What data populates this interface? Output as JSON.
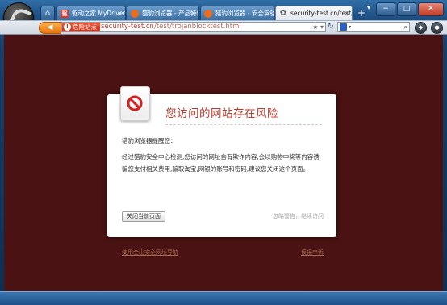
{
  "tabs": [
    {
      "label": "驱动之家 MyDrivers--",
      "icon_label": "驱",
      "icon_color": "#d9342b",
      "active": false
    },
    {
      "label": "猎豹浏览器 - 产品特性",
      "icon_label": "",
      "icon_color": "#ef6a1a",
      "active": false
    },
    {
      "label": "猎豹浏览器 - 安全实验",
      "icon_label": "",
      "icon_color": "#ef6a1a",
      "active": false
    },
    {
      "label": "security-test.cn/test/t",
      "icon_label": "",
      "icon_color": "#555555",
      "active": true
    }
  ],
  "toolbar": {
    "back_icon": "back-arrow-icon",
    "danger_badge": "危险站点",
    "url_domain": "security-test.cn",
    "url_path": "/test/trojanblocktest.html"
  },
  "warning": {
    "title": "您访问的网站存在风险",
    "greeting": "猎豹浏览器提醒您：",
    "message": "经过猎豹安全中心检测,您访问的网址含有欺诈内容,会以购物中奖等内容诱骗您支付相关费用,骗取淘宝,网银的账号和密码,建议您关闭这个页面。",
    "close_button": "关闭当前页面",
    "ignore_link": "忽略警告，继续访问",
    "nav_link": "使用金山安全网址导航",
    "report_link": "误报申诉"
  },
  "colors": {
    "page_background": "#4a1212",
    "title_red": "#c0392b",
    "danger_orange": "#e8740d"
  }
}
